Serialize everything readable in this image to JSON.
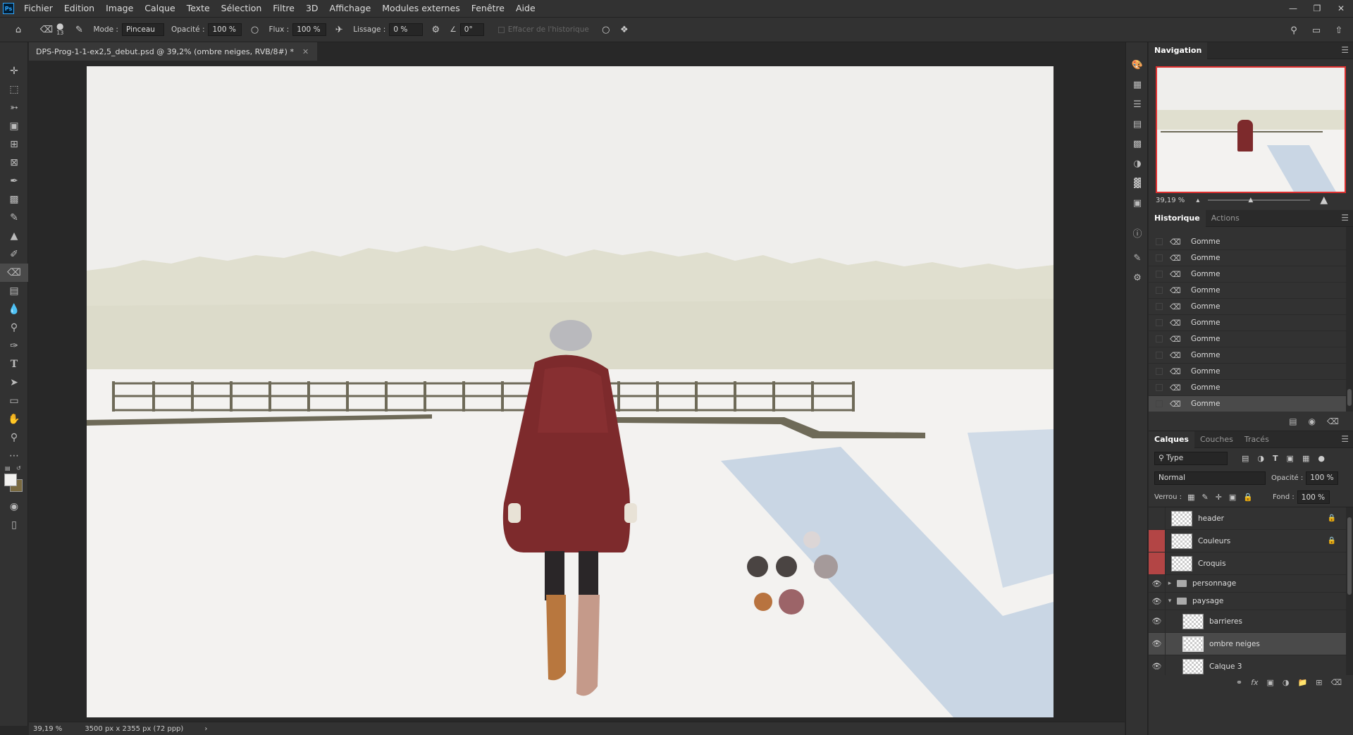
{
  "app": {
    "logo": "Ps"
  },
  "menu": [
    "Fichier",
    "Edition",
    "Image",
    "Calque",
    "Texte",
    "Sélection",
    "Filtre",
    "3D",
    "Affichage",
    "Modules externes",
    "Fenêtre",
    "Aide"
  ],
  "options": {
    "brush_size": "13",
    "mode_label": "Mode :",
    "mode_value": "Pinceau",
    "opacity_label": "Opacité :",
    "opacity_value": "100 %",
    "flow_label": "Flux :",
    "flow_value": "100 %",
    "smoothing_label": "Lissage :",
    "smoothing_value": "0 %",
    "angle_value": "0°",
    "erase_history_label": "Effacer de l'historique"
  },
  "document": {
    "tab_title": "DPS-Prog-1-1-ex2,5_debut.psd @ 39,2% (ombre neiges, RVB/8#) *",
    "zoom": "39,19 %",
    "dimensions": "3500 px x 2355 px (72 ppp)"
  },
  "navigation": {
    "title": "Navigation",
    "zoom": "39,19 %"
  },
  "history": {
    "tabs": [
      "Historique",
      "Actions"
    ],
    "items": [
      "Gomme",
      "Gomme",
      "Gomme",
      "Gomme",
      "Gomme",
      "Gomme",
      "Gomme",
      "Gomme",
      "Gomme",
      "Gomme",
      "Gomme"
    ]
  },
  "layers_panel": {
    "tabs": [
      "Calques",
      "Couches",
      "Tracés"
    ],
    "filter": "Type",
    "blend_mode": "Normal",
    "opacity_label": "Opacité :",
    "opacity_value": "100 %",
    "lock_label": "Verrou :",
    "fill_label": "Fond :",
    "fill_value": "100 %",
    "layers": [
      {
        "name": "header",
        "locked": true
      },
      {
        "name": "Couleurs",
        "locked": true
      },
      {
        "name": "Croquis",
        "locked": false
      },
      {
        "name": "personnage",
        "group": true
      },
      {
        "name": "paysage",
        "group": true
      },
      {
        "name": "barrieres"
      },
      {
        "name": "ombre neiges",
        "selected": true
      },
      {
        "name": "Calque 3"
      }
    ]
  },
  "colors": {
    "foreground": "#f2f1ef",
    "background": "#7a6a40",
    "coat": "#7d2a2c",
    "shadow": "#c9d6e4",
    "tree": "#dcdccb"
  }
}
